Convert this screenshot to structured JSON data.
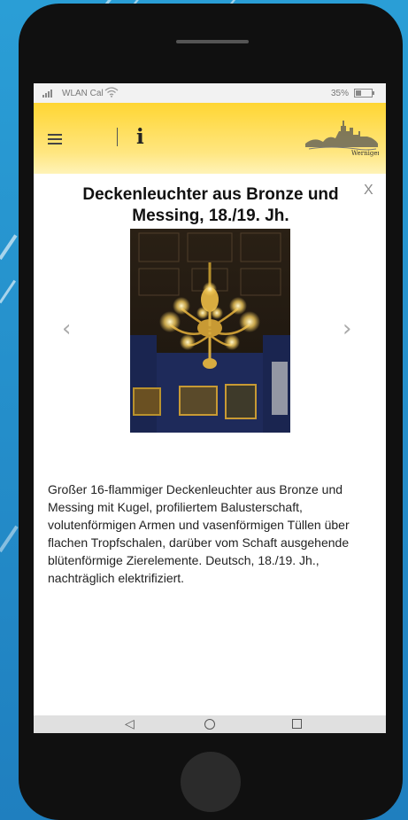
{
  "status_bar": {
    "carrier": "WLAN Cal",
    "battery": "35%"
  },
  "app_bar": {
    "info_label": "i"
  },
  "item": {
    "title": "Deckenleuchter aus Bronze und Messing, 18./19. Jh.",
    "description": "Großer 16-flammiger Deckenleuchter aus Bronze und Messing mit Kugel, profiliertem Balusterschaft, volutenförmigen Armen und vasenförmigen Tüllen über flachen Tropfschalen, darüber vom Schaft ausgehende blütenförmige Zierelemente. Deutsch, 18./19. Jh., nachträglich elektrifiziert."
  },
  "controls": {
    "close": "X",
    "prev": "‹",
    "next": "›"
  },
  "system_nav": {
    "back": "◁"
  },
  "icons": {
    "menu": "hamburger-icon",
    "info": "info-icon",
    "close": "close-icon",
    "prev": "chevron-left-icon",
    "next": "chevron-right-icon",
    "wifi": "wifi-icon",
    "battery": "battery-icon"
  },
  "colors": {
    "app_bar": "#ffd633",
    "background": "#1f7fbf",
    "phone": "#101010"
  }
}
